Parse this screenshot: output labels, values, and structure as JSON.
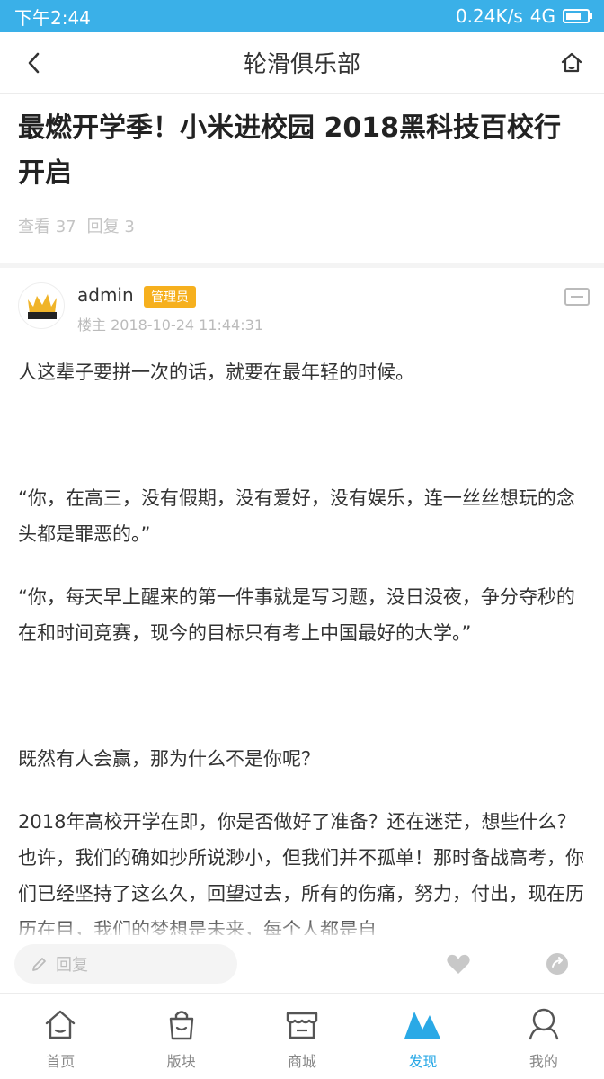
{
  "status_bar": {
    "time": "下午2:44",
    "network": "0.24K/s",
    "signal": "4G"
  },
  "nav": {
    "title": "轮滑俱乐部"
  },
  "article": {
    "title": "最燃开学季！小米进校园 2018黑科技百校行开启",
    "meta": {
      "views": "查看 37",
      "replies": "回复 3"
    }
  },
  "author": {
    "name": "admin",
    "badge": "管理员",
    "time": "楼主 2018-10-24 11:44:31"
  },
  "content": {
    "p1": "人这辈子要拼一次的话，就要在最年轻的时候。",
    "p2": "“你，在高三，没有假期，没有爱好，没有娱乐，连一丝丝想玩的念头都是罪恶的。”",
    "p3": "“你，每天早上醒来的第一件事就是写习题，没日没夜，争分夺秒的在和时间竞赛，现今的目标只有考上中国最好的大学。”",
    "p4": "既然有人会赢，那为什么不是你呢？",
    "p5": "2018年高校开学在即，你是否做好了准备？还在迷茫，想些什么？也许，我们的确如抄所说渺小，但我们并不孤单！那时备战高考，你们已经坚持了这么久，回望过去，所有的伤痛，努力，付出，现在历历在目，我们的梦想是未来，每个人都是自"
  },
  "reply_bar": {
    "placeholder": "回复"
  },
  "tabs": [
    {
      "label": "首页",
      "icon": "home-icon"
    },
    {
      "label": "版块",
      "icon": "bag-icon"
    },
    {
      "label": "商城",
      "icon": "shop-icon"
    },
    {
      "label": "发现",
      "icon": "mountain-icon"
    },
    {
      "label": "我的",
      "icon": "user-icon"
    }
  ],
  "colors": {
    "status_bar": "#3ab0e8",
    "accent": "#2aa9e6",
    "badge": "#f6b01e"
  }
}
